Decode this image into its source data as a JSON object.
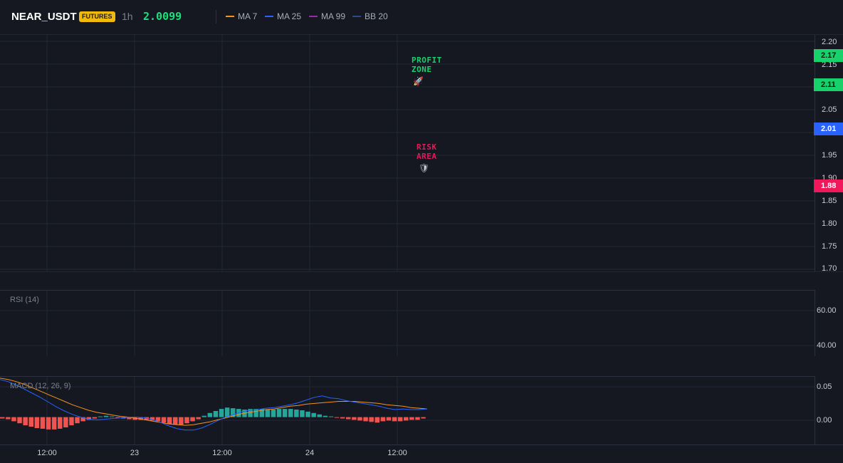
{
  "header": {
    "symbol": "NEAR_USDT",
    "badge": "FUTURES",
    "timeframe": "1h",
    "last_price": "2.0099",
    "indicators": [
      {
        "label": "MA 7",
        "color": "#f7931a"
      },
      {
        "label": "MA 25",
        "color": "#2962ff"
      },
      {
        "label": "MA 99",
        "color": "#9c27b0"
      },
      {
        "label": "BB 20",
        "color": "#2a4a8a"
      }
    ]
  },
  "price_axis": {
    "ticks": [
      "2.20",
      "2.15",
      "2.05",
      "1.95",
      "1.90",
      "1.85",
      "1.80",
      "1.75",
      "1.70"
    ],
    "markers": [
      {
        "label": "2.17",
        "color": "#17d16a",
        "text_color": "#0b1a10"
      },
      {
        "label": "2.11",
        "color": "#17d16a",
        "text_color": "#0b1a10"
      },
      {
        "label": "2.01",
        "color": "#2962ff",
        "text_color": "#ffffff"
      },
      {
        "label": "1.88",
        "color": "#f0185a",
        "text_color": "#ffffff"
      }
    ]
  },
  "annotations": {
    "profit": {
      "text": "PROFIT\nZONE",
      "color": "#17d16a",
      "icon": "rocket-icon",
      "glyph": "🚀"
    },
    "risk": {
      "text": "RISK\nAREA",
      "color": "#e0195a",
      "icon": "shield-icon",
      "glyph": "🛡"
    }
  },
  "rsi": {
    "label": "RSI (14)",
    "ticks": [
      "60.00",
      "40.00"
    ]
  },
  "macd": {
    "label": "MACD (12, 26, 9)",
    "ticks": [
      "0.05",
      "0.00"
    ],
    "histogram": [
      -0.002,
      -0.003,
      -0.006,
      -0.009,
      -0.012,
      -0.014,
      -0.016,
      -0.017,
      -0.018,
      -0.018,
      -0.017,
      -0.015,
      -0.012,
      -0.009,
      -0.006,
      -0.004,
      -0.002,
      0.001,
      0.002,
      0.001,
      -0.001,
      -0.002,
      -0.003,
      -0.004,
      -0.004,
      -0.004,
      -0.005,
      -0.006,
      -0.008,
      -0.01,
      -0.011,
      -0.011,
      -0.009,
      -0.006,
      -0.003,
      0.002,
      0.006,
      0.009,
      0.012,
      0.014,
      0.013,
      0.012,
      0.011,
      0.012,
      0.012,
      0.012,
      0.011,
      0.011,
      0.012,
      0.012,
      0.012,
      0.011,
      0.01,
      0.008,
      0.006,
      0.004,
      0.002,
      0.001,
      -0.001,
      -0.002,
      -0.003,
      -0.004,
      -0.005,
      -0.006,
      -0.007,
      -0.008,
      -0.006,
      -0.005,
      -0.006,
      -0.006,
      -0.005,
      -0.004,
      -0.004,
      -0.002
    ],
    "macd_line": [
      0.055,
      0.052,
      0.047,
      0.041,
      0.035,
      0.029,
      0.022,
      0.015,
      0.009,
      0.004,
      0.0,
      -0.003,
      -0.004,
      -0.003,
      -0.002,
      -0.001,
      0.0,
      0.0,
      -0.001,
      -0.004,
      -0.008,
      -0.013,
      -0.017,
      -0.019,
      -0.019,
      -0.016,
      -0.011,
      -0.005,
      0.0,
      0.004,
      0.008,
      0.01,
      0.011,
      0.013,
      0.014,
      0.016,
      0.018,
      0.021,
      0.025,
      0.029,
      0.031,
      0.028,
      0.027,
      0.024,
      0.022,
      0.02,
      0.018,
      0.016,
      0.013,
      0.011,
      0.012,
      0.011,
      0.011,
      0.012
    ],
    "signal_line": [
      0.057,
      0.055,
      0.052,
      0.048,
      0.043,
      0.038,
      0.033,
      0.028,
      0.023,
      0.018,
      0.014,
      0.01,
      0.007,
      0.005,
      0.003,
      0.001,
      0.0,
      -0.002,
      -0.004,
      -0.006,
      -0.008,
      -0.01,
      -0.011,
      -0.012,
      -0.011,
      -0.009,
      -0.007,
      -0.004,
      -0.001,
      0.002,
      0.005,
      0.007,
      0.009,
      0.011,
      0.012,
      0.014,
      0.016,
      0.017,
      0.019,
      0.02,
      0.021,
      0.022,
      0.023,
      0.023,
      0.023,
      0.022,
      0.021,
      0.02,
      0.018,
      0.017,
      0.016,
      0.014,
      0.013,
      0.012
    ],
    "ylim": [
      -0.04,
      0.06
    ]
  },
  "x_axis": {
    "ticks": [
      "12:00",
      "23",
      "12:00",
      "24",
      "12:00"
    ]
  }
}
